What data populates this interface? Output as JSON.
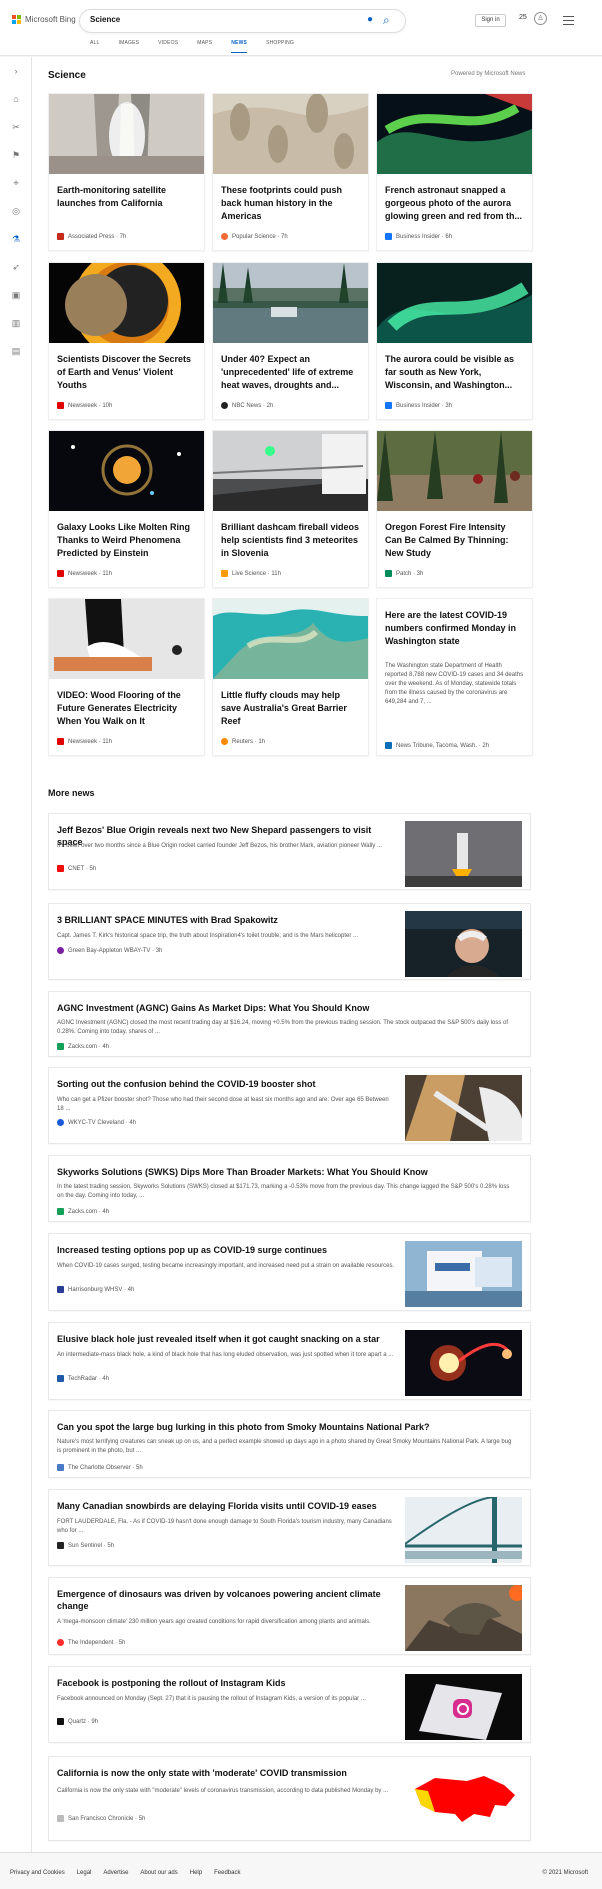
{
  "header": {
    "brand": "Microsoft Bing",
    "search_value": "Science",
    "signin": "Sign in",
    "reward_points": "25",
    "tabs": [
      "ALL",
      "IMAGES",
      "VIDEOS",
      "MAPS",
      "NEWS",
      "SHOPPING"
    ],
    "active_tab": "NEWS",
    "colors": {
      "accent": "#0a63c7",
      "logo_red": "#f25022",
      "logo_green": "#7fba00",
      "logo_blue": "#00a4ef",
      "logo_yellow": "#ffb900"
    }
  },
  "science": {
    "title": "Science",
    "powered": "Powered by Microsoft News",
    "cards": [
      {
        "title": "Earth-monitoring satellite launches from California",
        "source": "Associated Press · 7h",
        "icon": "associated-press-icon"
      },
      {
        "title": "These footprints could push back human history in the Americas",
        "source": "Popular Science · 7h",
        "icon": "popular-science-icon"
      },
      {
        "title": "French astronaut snapped a gorgeous photo of the aurora glowing green and red from th...",
        "source": "Business Insider · 6h",
        "icon": "business-insider-icon"
      },
      {
        "title": "Scientists Discover the Secrets of Earth and Venus' Violent Youths",
        "source": "Newsweek · 10h",
        "icon": "newsweek-icon"
      },
      {
        "title": "Under 40? Expect an 'unprecedented' life of extreme heat waves, droughts and...",
        "source": "NBC News · 2h",
        "icon": "nbc-news-icon"
      },
      {
        "title": "The aurora could be visible as far south as New York, Wisconsin, and Washington...",
        "source": "Business Insider · 3h",
        "icon": "business-insider-icon"
      },
      {
        "title": "Galaxy Looks Like Molten Ring Thanks to Weird Phenomena Predicted by Einstein",
        "source": "Newsweek · 11h",
        "icon": "newsweek-icon"
      },
      {
        "title": "Brilliant dashcam fireball videos help scientists find 3 meteorites in Slovenia",
        "source": "Live Science · 11h",
        "icon": "live-science-icon"
      },
      {
        "title": "Oregon Forest Fire Intensity Can Be Calmed By Thinning: New Study",
        "source": "Patch · 3h",
        "icon": "patch-icon"
      },
      {
        "title": "VIDEO: Wood Flooring of the Future Generates Electricity When You Walk on It",
        "source": "Newsweek · 11h",
        "icon": "newsweek-icon"
      },
      {
        "title": "Little fluffy clouds may help save Australia's Great Barrier Reef",
        "source": "Reuters · 1h",
        "icon": "reuters-icon"
      },
      {
        "title": "Here are the latest COVID-19 numbers confirmed Monday in Washington state",
        "summary": "The Washington state Department of Health reported 8,788 new COVID-19 cases and 34 deaths over the weekend. As of Monday, statewide totals from the illness caused by the coronavirus are 649,284 and 7, ...",
        "source": "News Tribune, Tacoma, Wash. · 2h",
        "icon": "news-tribune-icon"
      }
    ]
  },
  "more": {
    "title": "More news",
    "items": [
      {
        "title": "Jeff Bezos' Blue Origin reveals next two New Shepard passengers to visit space",
        "summary": "It's been over two months since a Blue Origin rocket carried founder Jeff Bezos, his brother Mark, aviation pioneer Wally ...",
        "source": "CNET · 5h"
      },
      {
        "title": "3 BRILLIANT SPACE MINUTES with Brad Spakowitz",
        "summary": "Capt. James T. Kirk's historical space trip, the truth about Inspiration4's toilet trouble, and is the Mars helicopter ...",
        "source": "Green Bay-Appleton WBAY-TV · 3h"
      },
      {
        "title": "AGNC Investment (AGNC) Gains As Market Dips: What You Should Know",
        "summary": "AGNC Investment (AGNC) closed the most recent trading day at $16.24, moving +0.5% from the previous trading session. The stock outpaced the S&P 500's daily loss of 0.28%. Coming into today, shares of ...",
        "source": "Zacks.com · 4h"
      },
      {
        "title": "Sorting out the confusion behind the COVID-19 booster shot",
        "summary": "Who can get a Pfizer booster shot? Those who had their second dose at least six months ago and are: Over age 65 Between 18 ...",
        "source": "WKYC-TV Cleveland · 4h"
      },
      {
        "title": "Skyworks Solutions (SWKS) Dips More Than Broader Markets: What You Should Know",
        "summary": "In the latest trading session, Skyworks Solutions (SWKS) closed at $171.73, marking a -0.53% move from the previous day. This change lagged the S&P 500's 0.28% loss on the day. Coming into today, ...",
        "source": "Zacks.com · 4h"
      },
      {
        "title": "Increased testing options pop up as COVID-19 surge continues",
        "summary": "When COVID-19 cases surged, testing became increasingly important, and increased need put a strain on available resources.",
        "source": "Harrisonburg WHSV · 4h"
      },
      {
        "title": "Elusive black hole just revealed itself when it got caught snacking on a star",
        "summary": "An intermediate-mass black hole, a kind of black hole that has long eluded observation, was just spotted when it tore apart a ...",
        "source": "TechRadar · 4h"
      },
      {
        "title": "Can you spot the large bug lurking in this photo from Smoky Mountains National Park?",
        "summary": "Nature's most terrifying creatures can sneak up on us, and a perfect example showed up days ago in a photo shared by Great Smoky Mountains National Park. A large bug is prominent in the photo, but ...",
        "source": "The Charlotte Observer · 5h"
      },
      {
        "title": "Many Canadian snowbirds are delaying Florida visits until COVID-19 eases",
        "summary": "FORT LAUDERDALE, Fla. - As if COVID-19 hasn't done enough damage to South Florida's tourism industry, many Canadians who for ...",
        "source": "Sun Sentinel · 5h"
      },
      {
        "title": "Emergence of dinosaurs was driven by volcanoes powering ancient climate change",
        "summary": "A 'mega-monsoon climate' 230 million years ago created conditions for rapid diversification among plants and animals.",
        "source": "The Independent · 5h"
      },
      {
        "title": "Facebook is postponing the rollout of Instagram Kids",
        "summary": "Facebook announced on Monday (Sept. 27) that it is pausing the rollout of Instagram Kids, a version of its popular ...",
        "source": "Quartz · 9h"
      },
      {
        "title": "California is now the only state with 'moderate' COVID transmission",
        "summary": "California is now the only state with \"moderate\" levels of coronavirus transmission, according to data published Monday by ...",
        "source": "San Francisco Chronicle · 5h"
      }
    ]
  },
  "footer": {
    "links": [
      "Privacy and Cookies",
      "Legal",
      "Advertise",
      "About our ads",
      "Help",
      "Feedback"
    ],
    "copyright": "© 2021 Microsoft"
  }
}
